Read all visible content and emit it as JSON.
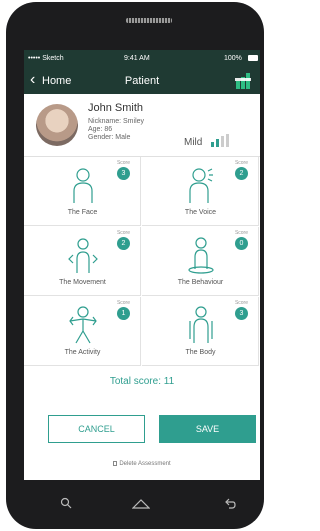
{
  "status_bar": {
    "carrier": "••••• Sketch",
    "time": "9:41 AM",
    "battery": "100%"
  },
  "nav": {
    "back_label": "Home",
    "title": "Patient",
    "action_icon": "growth-bars-icon"
  },
  "patient": {
    "name": "John Smith",
    "nickname": "Nickname: Smiley",
    "age": "Age: 86",
    "gender": "Gender: Male",
    "severity": "Mild"
  },
  "categories": [
    {
      "label": "The Face",
      "score_label": "Score",
      "score": "3",
      "icon": "face-icon"
    },
    {
      "label": "The Voice",
      "score_label": "Score",
      "score": "2",
      "icon": "voice-icon"
    },
    {
      "label": "The Movement",
      "score_label": "Score",
      "score": "2",
      "icon": "movement-icon"
    },
    {
      "label": "The Behaviour",
      "score_label": "Score",
      "score": "0",
      "icon": "behaviour-icon"
    },
    {
      "label": "The Activity",
      "score_label": "Score",
      "score": "1",
      "icon": "activity-icon"
    },
    {
      "label": "The Body",
      "score_label": "Score",
      "score": "3",
      "icon": "body-icon"
    }
  ],
  "total": "Total score: 11",
  "buttons": {
    "cancel": "CANCEL",
    "save": "SAVE",
    "delete": "Delete Assessment"
  },
  "colors": {
    "accent": "#2f9e8f",
    "header": "#1f3a33"
  }
}
